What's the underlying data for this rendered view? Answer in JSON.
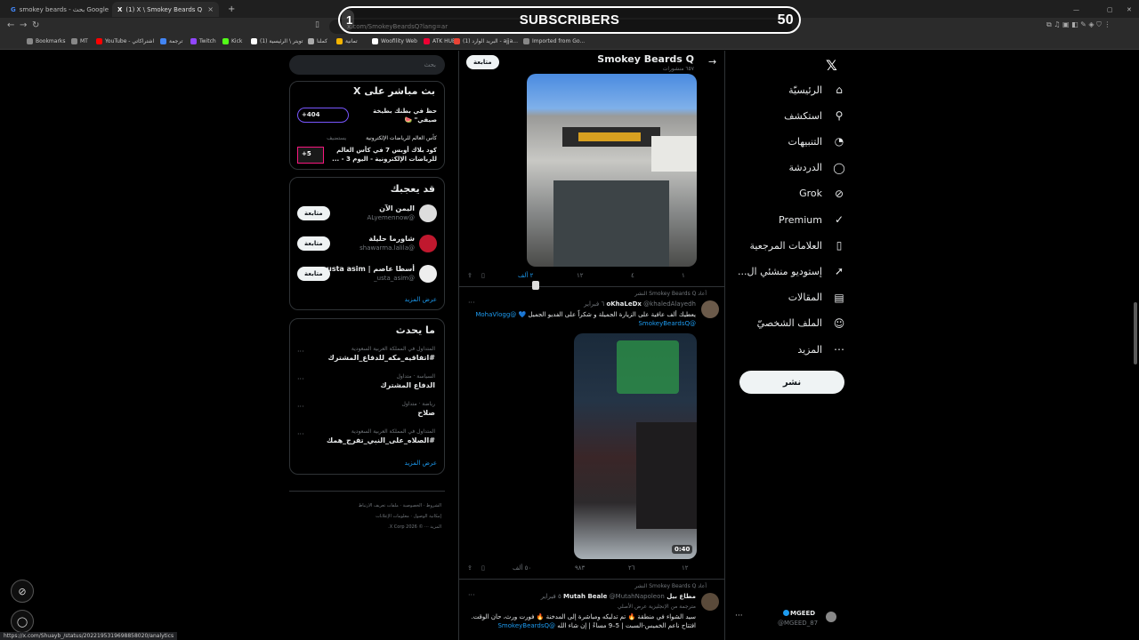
{
  "browser": {
    "tabs": [
      {
        "label": "smokey beards - بحث Google"
      },
      {
        "label": "(1) X \\ Smokey Beards Q (@Smo..."
      }
    ],
    "url": "x.com/SmokeyBeardsQ?lang=ar",
    "bookmarks": [
      {
        "label": "Bookmarks",
        "color": "#888"
      },
      {
        "label": "MT",
        "color": "#888"
      },
      {
        "label": "YouTube - اشتراكاتي",
        "color": "#ff0000"
      },
      {
        "label": "ترجمة",
        "color": "#4285f4"
      },
      {
        "label": "Twitch",
        "color": "#9146ff"
      },
      {
        "label": "Kick",
        "color": "#53fc18"
      },
      {
        "label": "(1) تويتر \\ الرئيسية",
        "color": "#fff"
      },
      {
        "label": "كملنا",
        "color": "#aaa"
      },
      {
        "label": "تمانية",
        "color": "#f4b400"
      },
      {
        "label": "Woofility Web",
        "color": "#fff"
      },
      {
        "label": "ATK HUB",
        "color": "#e03"
      },
      {
        "label": "(1) البريد الوارد - ajja...",
        "color": "#ea4335"
      },
      {
        "label": "Imported from Go...",
        "color": "#888"
      }
    ],
    "status_url": "https://x.com/Shuayb_/status/2022195319698858020/analytics"
  },
  "overlay": {
    "label": "SUBSCRIBERS",
    "start": "1",
    "goal": "50"
  },
  "sidebar_nav": [
    {
      "label": "الرئيسيّة",
      "icon": "home-icon",
      "glyph": "⌂"
    },
    {
      "label": "استكشف",
      "icon": "search-icon",
      "glyph": "⚲"
    },
    {
      "label": "التنبيهات",
      "icon": "bell-icon",
      "glyph": "◔"
    },
    {
      "label": "الدردشة",
      "icon": "chat-icon",
      "glyph": "◯"
    },
    {
      "label": "Grok",
      "icon": "grok-icon",
      "glyph": "⊘"
    },
    {
      "label": "Premium",
      "icon": "premium-icon",
      "glyph": "✓"
    },
    {
      "label": "العلامات المرجعية",
      "icon": "bookmark-icon",
      "glyph": "▯"
    },
    {
      "label": "إستوديو منشئي ال...",
      "icon": "rocket-icon",
      "glyph": "➚"
    },
    {
      "label": "المقالات",
      "icon": "articles-icon",
      "glyph": "▤"
    },
    {
      "label": "الملف الشخصيّ",
      "icon": "profile-icon",
      "glyph": "☺"
    },
    {
      "label": "المزيد",
      "icon": "more-icon",
      "glyph": "⋯"
    }
  ],
  "post_button": "نشر",
  "account": {
    "name": "MGEED",
    "handle": "@MGEED_87"
  },
  "profile_header": {
    "name": "Smokey Beards Q",
    "posts": "٦٥٧ منشورات",
    "follow": "متابعة"
  },
  "tweet1_actions": {
    "reply": "١",
    "retweet": "٤",
    "like": "١٢",
    "views": "٢ ألف"
  },
  "tweet2": {
    "repost_by": "أعاد Smokey Beards Q النشر",
    "author": "oKhaLeDx",
    "handle": "@khaledAlayedh",
    "date": "٦ فبراير",
    "text": "يعطيك ألف عافية على الزيارة الجميلة و شكراً على الفديو الجميل 💙",
    "mention1": "@MohaVlogg",
    "mention2": "@SmokeyBeardsQ",
    "video_duration": "0:40",
    "actions": {
      "reply": "١٢",
      "retweet": "٢٦",
      "like": "٩٨٣",
      "views": "٥٠ ألف"
    }
  },
  "tweet3": {
    "repost_by": "أعاد Smokey Beards Q النشر",
    "author": "مطاع بيل Mutah Beale",
    "handle": "@MutahNapoleon",
    "date": "٥ فبراير",
    "translated": "مترجمة من الإنجليزية عرض الأصلي",
    "text": "سيد الشواء في منطقة 🔥 تم تدليكه ومباشرة إلى المدخنة 🔥 فورت ورث، حان الوقت. افتتاح ناعم الخميس-السبت | 5–9 مساءً | إن شاء الله",
    "mention": "@SmokeyBeardsQ"
  },
  "search": {
    "placeholder": "بحث"
  },
  "live": {
    "title": "بث مباشر على X",
    "items": [
      {
        "text": "حظ في بطنك بطيخة صيفي\" 🍉",
        "badge": "+404"
      },
      {
        "host": "كأس العالم للرياضات الإلكترونية",
        "tag": "يستضيف",
        "text": "كود بلاك أوبس 7 في كأس العالم للرياضات الإلكترونية - اليوم 3 - ...",
        "badge": "+5"
      }
    ]
  },
  "who_to_follow": {
    "title": "قد يعجبك",
    "follow_label": "متابعة",
    "items": [
      {
        "name": "اليمن الآن",
        "handle": "@ALyemennow"
      },
      {
        "name": "شاورما حليلة",
        "handle": "@shawarma.lalila"
      },
      {
        "name": "أسطا عاصم | usta asim...",
        "handle": "@usta_asim_"
      }
    ],
    "more": "عرض المزيد"
  },
  "trends": {
    "title": "ما يحدث",
    "items": [
      {
        "context": "المتداول في المملكة العربية السعودية",
        "topic": "#اتفاقيه_مكه_للدفاع_المشترك"
      },
      {
        "context": "السياسة · متداول",
        "topic": "الدفاع المشترك"
      },
      {
        "context": "رياضة · متداول",
        "topic": "صلاح"
      },
      {
        "context": "المتداول في المملكة العربية السعودية",
        "topic": "#الصلاه_على_النبي_تفرج_همك"
      }
    ],
    "more": "عرض المزيد"
  },
  "footer": {
    "line1": "الشروط · الخصوصية · ملفات تعريف الارتباط",
    "line2": "إمكانية الوصول · معلومات الإعلانات",
    "line3": "المزيد ··· © 2026 X Corp."
  }
}
